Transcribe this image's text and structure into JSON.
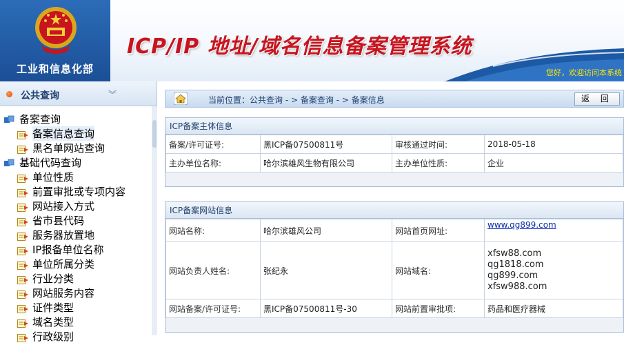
{
  "header": {
    "ministry": "工业和信息化部",
    "system_title": "ICP/IP 地址/域名信息备案管理系统",
    "welcome": "您好，欢迎访问本系统"
  },
  "sidebar": {
    "section_title": "公共查询",
    "categories": [
      {
        "label": "备案查询",
        "items": [
          "备案信息查询",
          "黑名单网站查询"
        ]
      },
      {
        "label": "基础代码查询",
        "items": [
          "单位性质",
          "前置审批或专项内容",
          "网站接入方式",
          "省市县代码",
          "服务器放置地",
          "IP报备单位名称",
          "单位所属分类",
          "行业分类",
          "网站服务内容",
          "证件类型",
          "域名类型",
          "行政级别"
        ]
      }
    ],
    "active_item": "备案信息查询"
  },
  "breadcrumb": {
    "prefix": "当前位置：",
    "path": [
      "公共查询",
      "备案查询",
      "备案信息"
    ],
    "separator": " - > "
  },
  "back_button": "返 回",
  "subject_panel": {
    "title": "ICP备案主体信息",
    "rows": [
      {
        "k1": "备案/许可证号:",
        "v1": "黑ICP备07500811号",
        "k2": "审核通过时间:",
        "v2": "2018-05-18"
      },
      {
        "k1": "主办单位名称:",
        "v1": "哈尔滨雄风生物有限公司",
        "k2": "主办单位性质:",
        "v2": "企业"
      }
    ]
  },
  "site_panel": {
    "title": "ICP备案网站信息",
    "site_name_label": "网站名称:",
    "site_name": "哈尔滨雄风公司",
    "homepage_label": "网站首页网址:",
    "homepage": "www.qg899.com",
    "owner_label": "网站负责人姓名:",
    "owner": "张纪永",
    "domain_label": "网站域名:",
    "domains": [
      "xfsw88.com",
      "qg1818.com",
      "qg899.com",
      "xfsw988.com"
    ],
    "license_label": "网站备案/许可证号:",
    "license": "黑ICP备07500811号-30",
    "preapproval_label": "网站前置审批项:",
    "preapproval": "药品和医疗器械"
  }
}
